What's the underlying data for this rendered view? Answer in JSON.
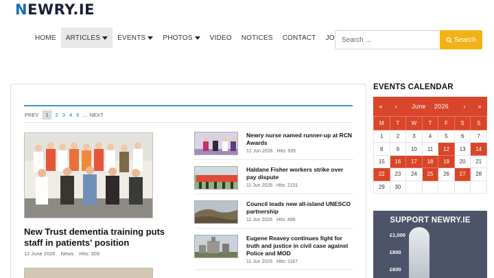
{
  "header": {
    "logo_first": "N",
    "logo_rest": "EWRY.IE"
  },
  "nav": {
    "items": [
      {
        "label": "HOME",
        "dropdown": false
      },
      {
        "label": "ARTICLES",
        "dropdown": true
      },
      {
        "label": "EVENTS",
        "dropdown": true
      },
      {
        "label": "PHOTOS",
        "dropdown": true
      },
      {
        "label": "VIDEO",
        "dropdown": false
      },
      {
        "label": "NOTICES",
        "dropdown": false
      },
      {
        "label": "CONTACT",
        "dropdown": false
      },
      {
        "label": "JOBS",
        "dropdown": false
      }
    ],
    "active": "ARTICLES"
  },
  "search": {
    "placeholder": "Search ...",
    "button_label": "Search",
    "icon": "search-icon"
  },
  "pagination": {
    "prev": "PREV",
    "current": "1",
    "pages": [
      "2",
      "3",
      "4",
      "5"
    ],
    "ellipsis": "...",
    "next": "NEXT"
  },
  "featured": {
    "title": "New Trust dementia training puts staff in patients' position",
    "date": "12 June 2026",
    "category": "News",
    "hits": "Hits: 309"
  },
  "articles": [
    {
      "title": "Newry nurse named runner-up at RCN Awards",
      "date": "12 Jun 2026",
      "hits": "Hits: 935"
    },
    {
      "title": "Haldane Fisher workers strike over pay dispute",
      "date": "11 Jun 2026",
      "hits": "Hits: 2151"
    },
    {
      "title": "Council leads new all-island UNESCO partnership",
      "date": "11 Jun 2026",
      "hits": "Hits: 486"
    },
    {
      "title": "Eugene Reavey continues fight for truth and justice in civil case against Police and MOD",
      "date": "11 Jun 2026",
      "hits": "Hits: 1167"
    }
  ],
  "calendar": {
    "heading": "EVENTS CALENDAR",
    "month": "June",
    "year": "2026",
    "weekdays": [
      "M",
      "T",
      "W",
      "T",
      "F",
      "S",
      "S"
    ],
    "weeks": [
      [
        "1",
        "2",
        "3",
        "4",
        "5",
        "6",
        "7"
      ],
      [
        "8",
        "9",
        "10",
        "11",
        "12",
        "13",
        "14"
      ],
      [
        "15",
        "16",
        "17",
        "18",
        "19",
        "20",
        "21"
      ],
      [
        "22",
        "23",
        "24",
        "25",
        "26",
        "27",
        "28"
      ],
      [
        "29",
        "30",
        "",
        "",
        "",
        "",
        ""
      ]
    ],
    "event_days": [
      "12",
      "14",
      "16",
      "17",
      "18",
      "19",
      "22",
      "25",
      "27"
    ],
    "accent": "#d9452a"
  },
  "support": {
    "title": "SUPPORT NEWRY.IE",
    "levels": [
      "£1,000",
      "£800",
      "£600"
    ]
  },
  "colors": {
    "brand_blue": "#1a6fb5",
    "search_yellow": "#f2b215",
    "support_bg": "#4d5469"
  }
}
